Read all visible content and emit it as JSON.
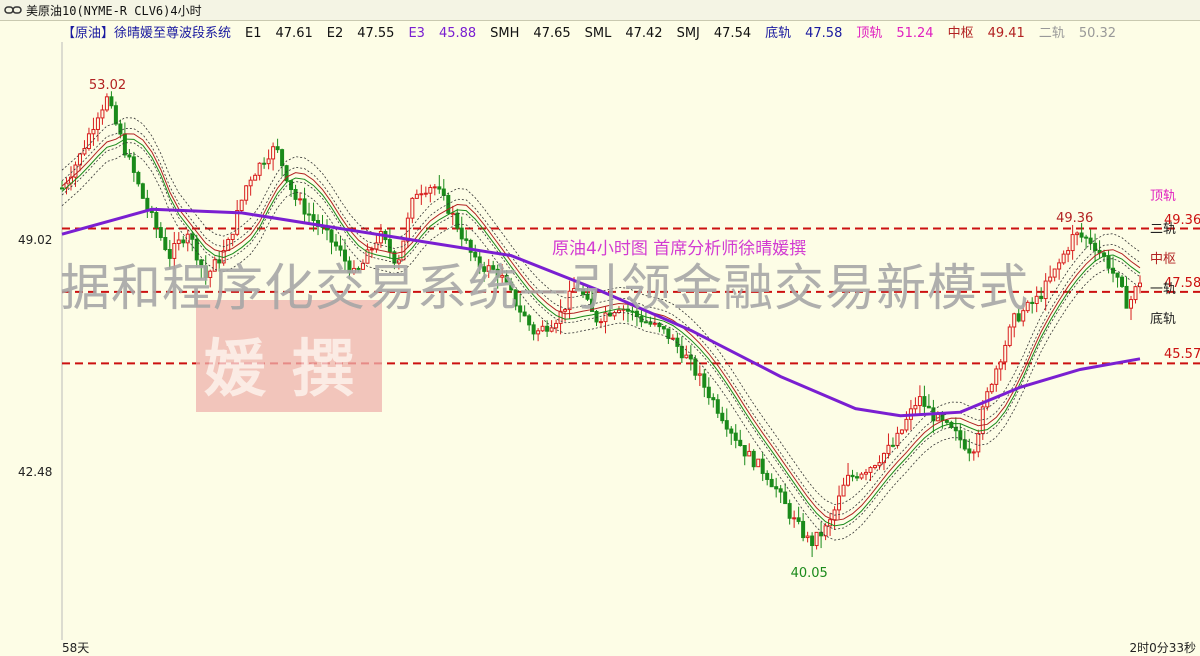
{
  "window": {
    "title": "美原油10(NYME-R CLV6)4小时"
  },
  "info_bar": [
    {
      "text": "【原油】徐晴媛至尊波段系统",
      "color": "#1a1aa0"
    },
    {
      "text": "E1",
      "color": "#111"
    },
    {
      "text": "47.61",
      "color": "#111"
    },
    {
      "text": "E2",
      "color": "#111"
    },
    {
      "text": "47.55",
      "color": "#111"
    },
    {
      "text": "E3",
      "color": "#7a1fd1"
    },
    {
      "text": "45.88",
      "color": "#7a1fd1"
    },
    {
      "text": "SMH",
      "color": "#111"
    },
    {
      "text": "47.65",
      "color": "#111"
    },
    {
      "text": "SML",
      "color": "#111"
    },
    {
      "text": "47.42",
      "color": "#111"
    },
    {
      "text": "SMJ",
      "color": "#111"
    },
    {
      "text": "47.54",
      "color": "#111"
    },
    {
      "text": "底轨",
      "color": "#1a1aa0"
    },
    {
      "text": "47.58",
      "color": "#1a1aa0"
    },
    {
      "text": "顶轨",
      "color": "#e020c0"
    },
    {
      "text": "51.24",
      "color": "#e020c0"
    },
    {
      "text": "中枢",
      "color": "#b22222"
    },
    {
      "text": "49.41",
      "color": "#b22222"
    },
    {
      "text": "二轨",
      "color": "#999"
    },
    {
      "text": "50.32",
      "color": "#999"
    }
  ],
  "watermark": {
    "text": "据和程序化交易系统—引领金融交易新模式",
    "stamp": "媛撰"
  },
  "annotation": "原油4小时图   首席分析师徐晴媛撰",
  "bottom": {
    "left": "58天",
    "right": "2时0分33秒"
  },
  "colors": {
    "up": "#d81e1e",
    "down": "#1a8a1a",
    "ma": "#7a1fd1",
    "dash_line": "#cc1111"
  },
  "chart_data": {
    "type": "candlestick",
    "y_ticks": [
      {
        "value": 49.02,
        "label": "49.02"
      },
      {
        "value": 42.48,
        "label": "42.48"
      }
    ],
    "ylim": [
      37.8,
      54.6
    ],
    "high_label": {
      "value": 53.02,
      "label": "53.02"
    },
    "low_label": {
      "value": 40.05,
      "label": "40.05"
    },
    "peak_label": {
      "value": 49.36,
      "label": "49.36"
    },
    "horizontal_levels": [
      {
        "name": "中枢",
        "value": 49.36,
        "label": "49.36"
      },
      {
        "name": "底轨",
        "value": 47.58,
        "label": "47.58"
      },
      {
        "name": "e3",
        "value": 45.57,
        "label": "45.57"
      }
    ],
    "right_rail_labels": [
      "顶轨",
      "二轨",
      "中枢",
      "一轨",
      "底轨"
    ],
    "close_path": [
      [
        0,
        50.5
      ],
      [
        6,
        51.4
      ],
      [
        12,
        52.6
      ],
      [
        15,
        53.0
      ],
      [
        20,
        51.8
      ],
      [
        28,
        50.0
      ],
      [
        36,
        48.6
      ],
      [
        42,
        49.3
      ],
      [
        48,
        48.0
      ],
      [
        55,
        48.8
      ],
      [
        62,
        50.7
      ],
      [
        70,
        51.6
      ],
      [
        72,
        51.5
      ],
      [
        78,
        50.2
      ],
      [
        84,
        49.6
      ],
      [
        92,
        48.8
      ],
      [
        98,
        48.0
      ],
      [
        106,
        49.2
      ],
      [
        112,
        48.4
      ],
      [
        118,
        50.4
      ],
      [
        124,
        50.6
      ],
      [
        130,
        49.8
      ],
      [
        138,
        48.4
      ],
      [
        146,
        48.1
      ],
      [
        152,
        47.2
      ],
      [
        158,
        46.4
      ],
      [
        166,
        46.9
      ],
      [
        172,
        47.8
      ],
      [
        178,
        46.8
      ],
      [
        186,
        47.2
      ],
      [
        194,
        46.8
      ],
      [
        202,
        46.4
      ],
      [
        208,
        45.8
      ],
      [
        214,
        45.0
      ],
      [
        222,
        43.9
      ],
      [
        228,
        43.1
      ],
      [
        236,
        42.4
      ],
      [
        244,
        41.2
      ],
      [
        250,
        40.5
      ],
      [
        256,
        41.0
      ],
      [
        262,
        42.3
      ],
      [
        270,
        42.7
      ],
      [
        278,
        43.3
      ],
      [
        286,
        44.6
      ],
      [
        292,
        44.0
      ],
      [
        298,
        43.6
      ],
      [
        304,
        43.1
      ],
      [
        310,
        45.0
      ],
      [
        318,
        46.8
      ],
      [
        326,
        47.4
      ],
      [
        332,
        48.2
      ],
      [
        338,
        49.2
      ],
      [
        344,
        49.0
      ],
      [
        350,
        48.3
      ],
      [
        356,
        47.2
      ],
      [
        360,
        47.9
      ]
    ],
    "ma_path": [
      [
        0,
        49.2
      ],
      [
        30,
        49.9
      ],
      [
        60,
        49.8
      ],
      [
        90,
        49.4
      ],
      [
        120,
        49.0
      ],
      [
        150,
        48.6
      ],
      [
        180,
        47.6
      ],
      [
        210,
        46.5
      ],
      [
        240,
        45.2
      ],
      [
        265,
        44.3
      ],
      [
        280,
        44.1
      ],
      [
        300,
        44.2
      ],
      [
        320,
        44.9
      ],
      [
        340,
        45.4
      ],
      [
        360,
        45.7
      ]
    ]
  }
}
